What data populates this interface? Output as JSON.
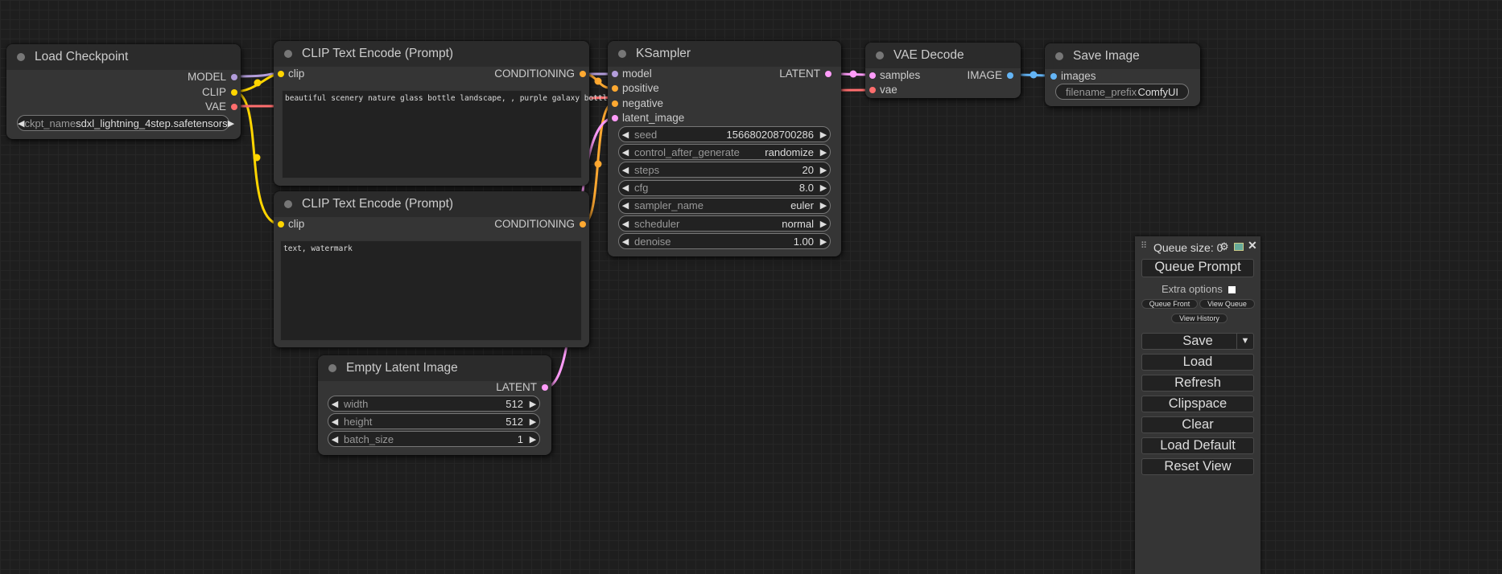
{
  "colors": {
    "model": "#b39ddb",
    "clip": "#ffd500",
    "vae": "#ff6e6e",
    "conditioning": "#ffa931",
    "latent": "#ff9cf9",
    "image": "#64b5f6"
  },
  "nodes": {
    "load_checkpoint": {
      "title": "Load Checkpoint",
      "outputs": [
        "MODEL",
        "CLIP",
        "VAE"
      ],
      "ckpt_label": "ckpt_name",
      "ckpt_value": "sdxl_lightning_4step.safetensors"
    },
    "clip_pos": {
      "title": "CLIP Text Encode (Prompt)",
      "input": "clip",
      "output": "CONDITIONING",
      "text": "beautiful scenery nature glass bottle landscape, , purple galaxy bottle,"
    },
    "clip_neg": {
      "title": "CLIP Text Encode (Prompt)",
      "input": "clip",
      "output": "CONDITIONING",
      "text": "text, watermark"
    },
    "ksampler": {
      "title": "KSampler",
      "inputs": [
        "model",
        "positive",
        "negative",
        "latent_image"
      ],
      "output": "LATENT",
      "widgets": [
        {
          "label": "seed",
          "value": "156680208700286"
        },
        {
          "label": "control_after_generate",
          "value": "randomize"
        },
        {
          "label": "steps",
          "value": "20"
        },
        {
          "label": "cfg",
          "value": "8.0"
        },
        {
          "label": "sampler_name",
          "value": "euler"
        },
        {
          "label": "scheduler",
          "value": "normal"
        },
        {
          "label": "denoise",
          "value": "1.00"
        }
      ]
    },
    "vae_decode": {
      "title": "VAE Decode",
      "inputs": [
        "samples",
        "vae"
      ],
      "output": "IMAGE"
    },
    "save_image": {
      "title": "Save Image",
      "input": "images",
      "prefix_label": "filename_prefix",
      "prefix_value": "ComfyUI"
    },
    "empty_latent": {
      "title": "Empty Latent Image",
      "output": "LATENT",
      "widgets": [
        {
          "label": "width",
          "value": "512"
        },
        {
          "label": "height",
          "value": "512"
        },
        {
          "label": "batch_size",
          "value": "1"
        }
      ]
    }
  },
  "menu": {
    "queue_size": "Queue size: 0",
    "queue_prompt": "Queue Prompt",
    "extra_options": "Extra options",
    "queue_front": "Queue Front",
    "view_queue": "View Queue",
    "view_history": "View History",
    "save": "Save",
    "load": "Load",
    "refresh": "Refresh",
    "clipspace": "Clipspace",
    "clear": "Clear",
    "load_default": "Load Default",
    "reset_view": "Reset View"
  }
}
